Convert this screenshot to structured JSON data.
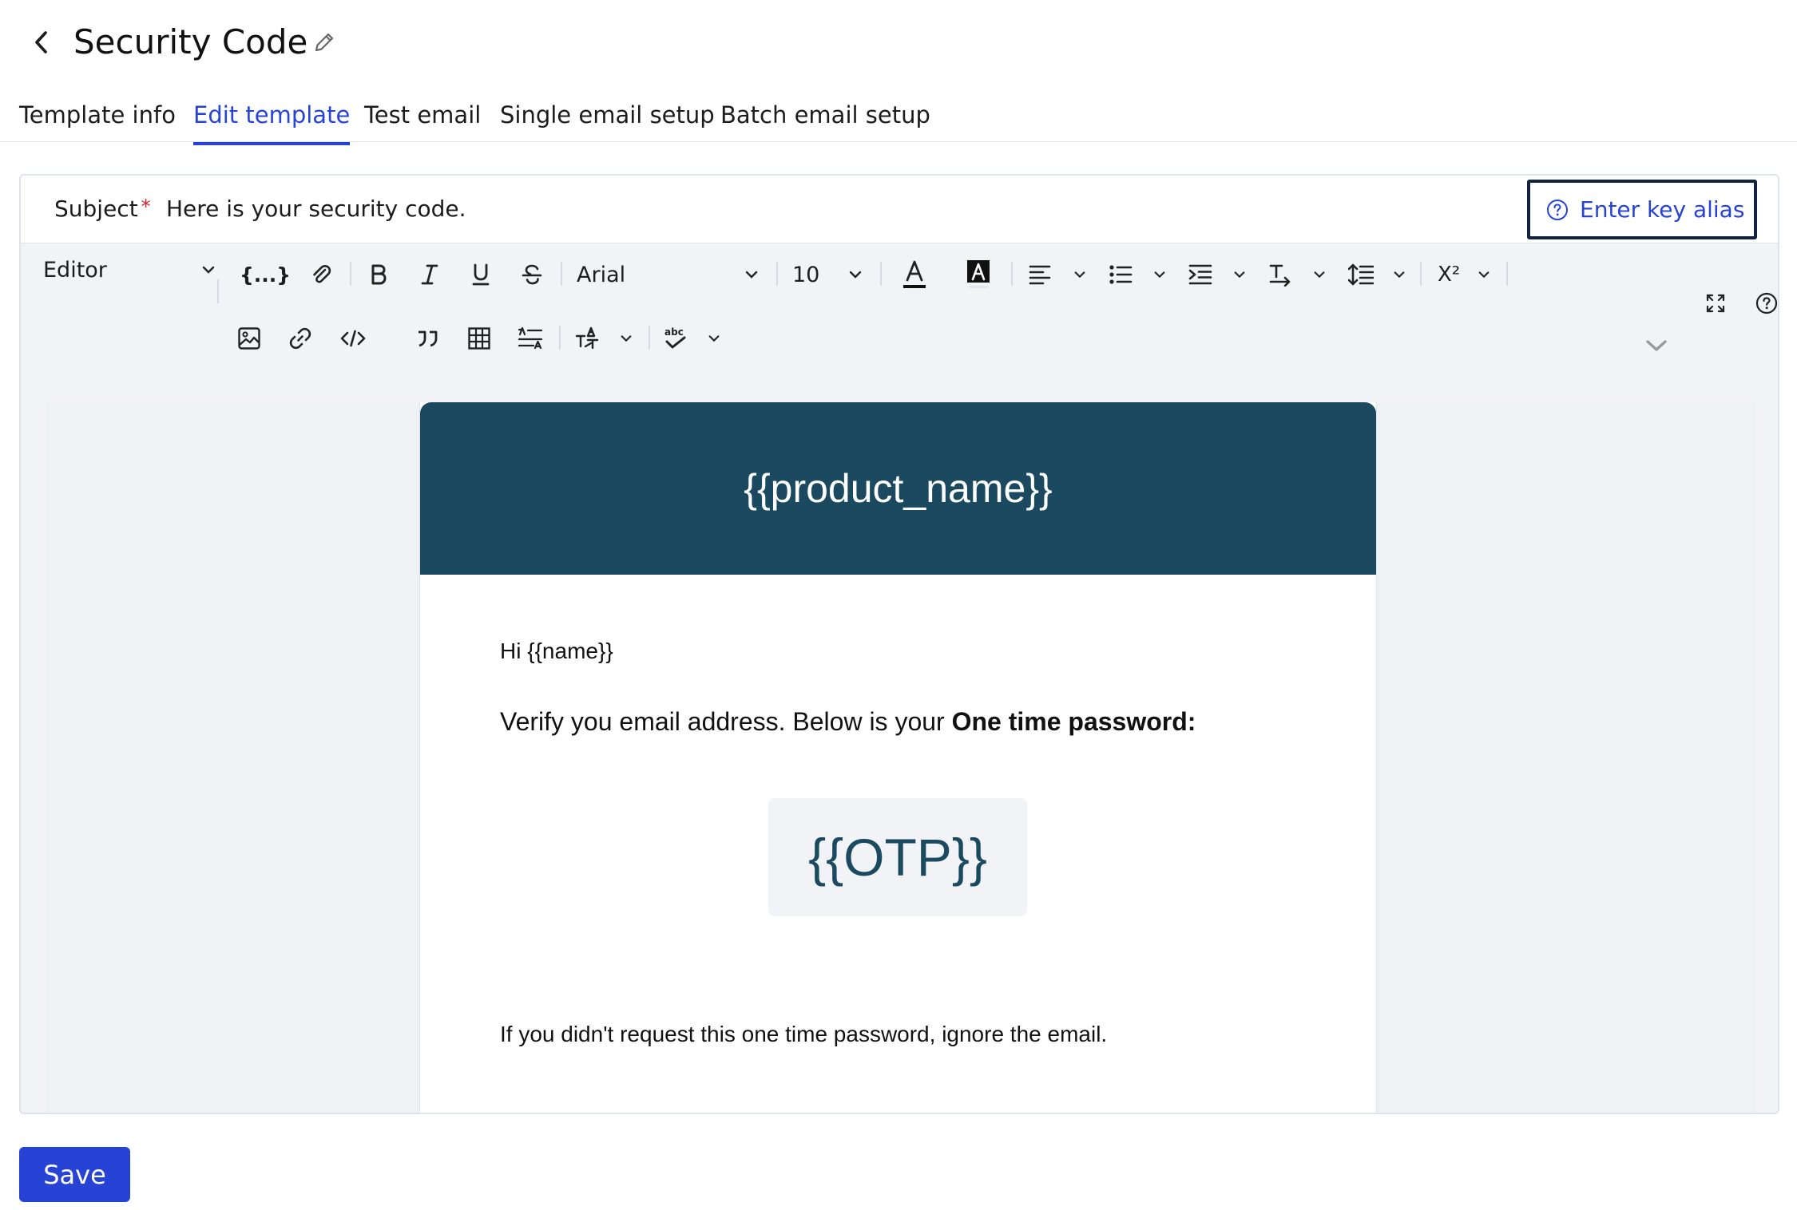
{
  "page": {
    "title": "Security Code"
  },
  "tabs": [
    {
      "label": "Template info",
      "active": false
    },
    {
      "label": "Edit template",
      "active": true
    },
    {
      "label": "Test email",
      "active": false
    },
    {
      "label": "Single email setup",
      "active": false
    },
    {
      "label": "Batch email setup",
      "active": false
    }
  ],
  "subject": {
    "label": "Subject",
    "required_marker": "*",
    "value": "Here is your security code.",
    "alias_button": "Enter key alias"
  },
  "toolbar": {
    "mode": "Editor",
    "font_family": "Arial",
    "font_size": "10",
    "merge_tag_label": "{...}",
    "superscript_label": "X²",
    "icons": [
      "merge-tag-icon",
      "attach-icon",
      "bold-icon",
      "italic-icon",
      "underline-icon",
      "strikethrough-icon",
      "font-color-icon",
      "background-color-icon",
      "align-icon",
      "bullet-list-icon",
      "indent-icon",
      "text-direction-icon",
      "line-height-icon",
      "superscript-icon",
      "fullscreen-icon",
      "help-icon",
      "image-icon",
      "link-icon",
      "code-icon",
      "quote-icon",
      "table-icon",
      "format-icon",
      "clear-format-icon",
      "spellcheck-icon",
      "collapse-toolbar-icon"
    ]
  },
  "email": {
    "header": "{{product_name}}",
    "greeting": "Hi {{name}}",
    "verify_text": "Verify you email address. Below is your ",
    "verify_bold": "One time password:",
    "otp": "{{OTP}}",
    "footer": "If you didn't request this one time password, ignore the email."
  },
  "actions": {
    "save": "Save"
  },
  "colors": {
    "accent": "#2743d6",
    "email_header_bg": "#1b4a60",
    "required": "#d8232a"
  }
}
